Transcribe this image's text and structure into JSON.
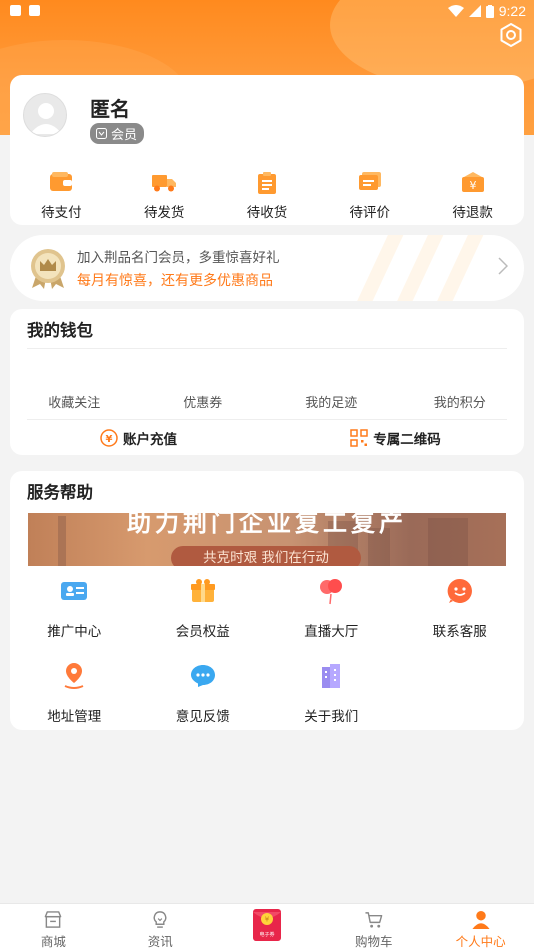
{
  "status_bar": {
    "time": "9:22"
  },
  "profile": {
    "username": "匿名",
    "member_label": "会员"
  },
  "orders": [
    {
      "label": "待支付",
      "icon": "wallet-icon"
    },
    {
      "label": "待发货",
      "icon": "truck-icon"
    },
    {
      "label": "待收货",
      "icon": "clipboard-icon"
    },
    {
      "label": "待评价",
      "icon": "comment-icon"
    },
    {
      "label": "待退款",
      "icon": "refund-icon"
    }
  ],
  "promo": {
    "line1": "加入荆品名门会员，多重惊喜好礼",
    "line2": "每月有惊喜，还有更多优惠商品"
  },
  "wallet": {
    "title": "我的钱包",
    "links": [
      "收藏关注",
      "优惠券",
      "我的足迹",
      "我的积分"
    ],
    "actions": [
      {
        "label": "账户充值",
        "icon": "yuan-circle-icon"
      },
      {
        "label": "专属二维码",
        "icon": "qr-code-icon"
      }
    ]
  },
  "service": {
    "title": "服务帮助",
    "banner_title": "助力荆门企业复工复产",
    "banner_subtitle": "共克时艰 我们在行动",
    "items": [
      {
        "label": "推广中心",
        "icon": "promotion-icon"
      },
      {
        "label": "会员权益",
        "icon": "gift-icon"
      },
      {
        "label": "直播大厅",
        "icon": "balloon-icon"
      },
      {
        "label": "联系客服",
        "icon": "chat-face-icon"
      },
      {
        "label": "地址管理",
        "icon": "location-icon"
      },
      {
        "label": "意见反馈",
        "icon": "feedback-icon"
      },
      {
        "label": "关于我们",
        "icon": "building-icon"
      }
    ]
  },
  "nav": [
    {
      "label": "商城",
      "icon": "store-icon"
    },
    {
      "label": "资讯",
      "icon": "bulb-icon"
    },
    {
      "label": "",
      "icon": "red-envelope-icon",
      "badge": "电子券"
    },
    {
      "label": "购物车",
      "icon": "cart-icon"
    },
    {
      "label": "个人中心",
      "icon": "person-icon",
      "active": true
    }
  ],
  "colors": {
    "accent": "#ff7a1a",
    "header": "#ff8a1e"
  }
}
